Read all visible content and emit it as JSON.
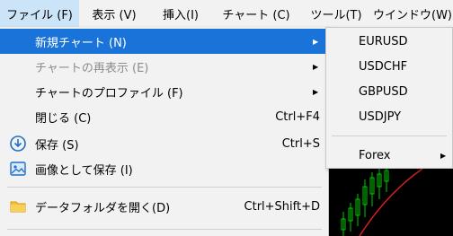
{
  "menubar": {
    "items": [
      {
        "label": "ファイル (F)",
        "active": true
      },
      {
        "label": "表示 (V)"
      },
      {
        "label": "挿入(I)"
      },
      {
        "label": "チャート (C)"
      },
      {
        "label": "ツール(T)"
      },
      {
        "label": "ウインドウ(W)"
      }
    ]
  },
  "file_menu": {
    "items": [
      {
        "label": "新規チャート (N)",
        "has_submenu": true,
        "highlighted": true
      },
      {
        "label": "チャートの再表示 (E)",
        "has_submenu": true,
        "disabled": true
      },
      {
        "label": "チャートのプロファイル (F)",
        "has_submenu": true
      },
      {
        "label": "閉じる (C)",
        "shortcut": "Ctrl+F4"
      },
      {
        "label": "保存 (S)",
        "shortcut": "Ctrl+S",
        "icon": "save-icon"
      },
      {
        "label": "画像として保存 (I)",
        "icon": "image-icon"
      },
      {
        "label": "データフォルダを開く(D)",
        "shortcut": "Ctrl+Shift+D",
        "icon": "folder-icon"
      }
    ]
  },
  "submenu": {
    "items": [
      {
        "label": "EURUSD"
      },
      {
        "label": "USDCHF"
      },
      {
        "label": "GBPUSD"
      },
      {
        "label": "USDJPY"
      },
      {
        "label": "Forex",
        "has_submenu": true
      }
    ]
  },
  "colors": {
    "highlight": "#1a73d9",
    "menubar_active": "#cce4f7",
    "chart_background": "#000000",
    "chart_candles": "#00c800",
    "chart_line": "#d02020"
  }
}
